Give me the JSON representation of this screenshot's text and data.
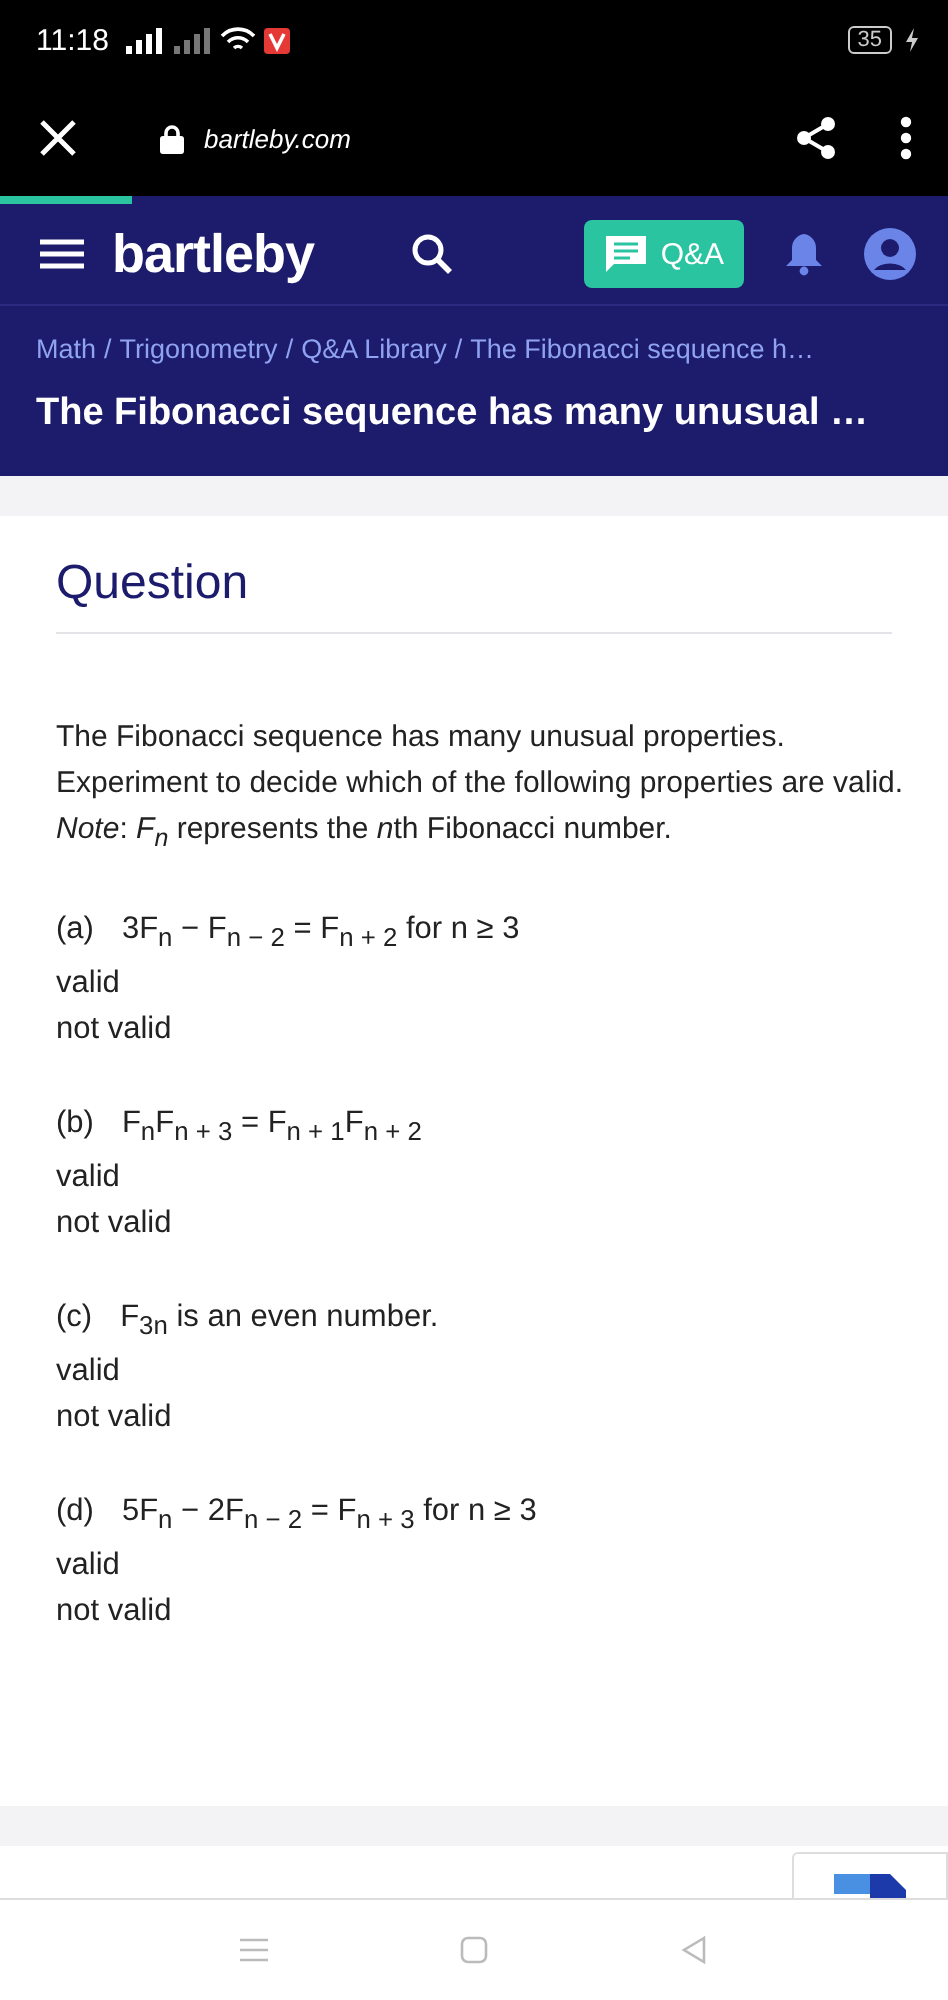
{
  "status_bar": {
    "time": "11:18",
    "battery": "35"
  },
  "browser": {
    "url": "bartleby.com",
    "progress": {
      "level": 0.14
    }
  },
  "header": {
    "logo": "bartleby",
    "qa_button": "Q&A"
  },
  "breadcrumb": [
    {
      "label": "Math"
    },
    {
      "separator": "/",
      "label": "Trigonometry"
    },
    {
      "separator": "/",
      "label": "Q&A Library"
    },
    {
      "separator": "/",
      "label": "The Fibonacci sequence h…"
    }
  ],
  "page_title": "The Fibonacci sequence has many unusual …",
  "question": {
    "heading": "Question",
    "intro": [
      {
        "text": "The Fibonacci sequence has many unusual properties. Experiment to decide which of the following properties are valid. ",
        "italic": false,
        "sub": false
      },
      {
        "text": "Note",
        "italic": true,
        "sub": false
      },
      {
        "text": ": ",
        "italic": false,
        "sub": false
      },
      {
        "text": "F",
        "italic": true,
        "sub": false
      },
      {
        "text": "n",
        "italic": true,
        "sub": true
      },
      {
        "text": " represents the ",
        "italic": false,
        "sub": false
      },
      {
        "text": "n",
        "italic": true,
        "sub": false
      },
      {
        "text": "th Fibonacci number.",
        "italic": false,
        "sub": false
      }
    ],
    "parts": [
      {
        "label": "(a)",
        "statement": "3F$_{n}$ − F$_{n − 2}$ = F$_{n + 2}$   for n ≥ 3",
        "options": [
          "valid",
          "not valid"
        ]
      },
      {
        "label": "(b)",
        "statement": "F$_{n}$F$_{n + 3}$ = F$_{n + 1}$F$_{n + 2}$",
        "options": [
          "valid",
          "not valid"
        ]
      },
      {
        "label": "(c)",
        "statement": "F$_{3n}$ is an even number.",
        "options": [
          "valid",
          "not valid"
        ]
      },
      {
        "label": "(d)",
        "statement": "5F$_{n}$ − 2F$_{n − 2}$ = F$_{n + 3}$   for n ≥ 3",
        "options": [
          "valid",
          "not valid"
        ]
      }
    ]
  }
}
